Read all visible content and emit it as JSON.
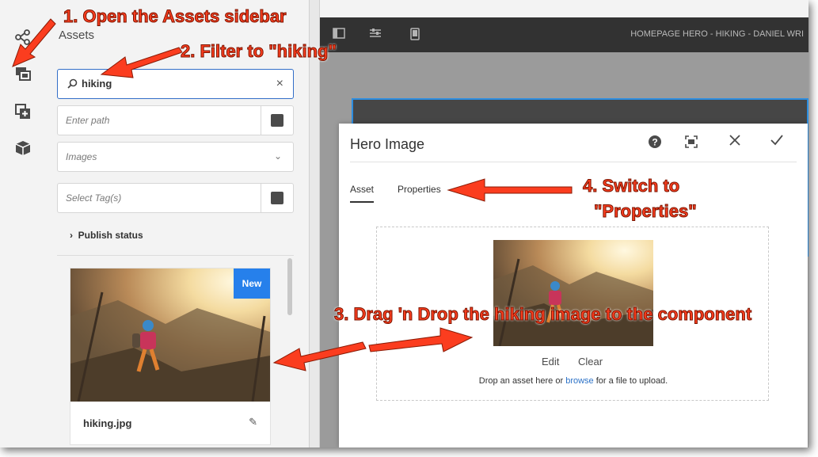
{
  "sidebar_rail": {
    "icons": [
      "share-icon",
      "assets-icon",
      "components-icon",
      "content-tree-icon"
    ]
  },
  "assets_panel": {
    "title": "Assets",
    "search": {
      "value": "hiking"
    },
    "path_field": {
      "placeholder": "Enter path"
    },
    "type_select": {
      "value": "Images"
    },
    "tags_field": {
      "placeholder": "Select Tag(s)"
    },
    "publish_status_label": "Publish status",
    "asset_card": {
      "badge": "New",
      "filename": "hiking.jpg"
    }
  },
  "editor": {
    "page_title": "HOMEPAGE HERO - HIKING - DANIEL WRI"
  },
  "dialog": {
    "title": "Hero Image",
    "tabs": [
      {
        "label": "Asset",
        "active": true
      },
      {
        "label": "Properties",
        "active": false
      }
    ],
    "edit_label": "Edit",
    "clear_label": "Clear",
    "drop_hint_before": "Drop an asset here or ",
    "drop_hint_link": "browse",
    "drop_hint_after": " for a file to upload."
  },
  "annotations": {
    "step1": "1. Open the Assets sidebar",
    "step2": "2. Filter to \"hiking\"",
    "step3": "3. Drag 'n Drop the hiking image to the component",
    "step4_line1": "4. Switch to",
    "step4_line2": "\"Properties\""
  },
  "colors": {
    "accent": "#2680eb",
    "annotation": "#fb3d1f",
    "toolbar": "#323232"
  }
}
